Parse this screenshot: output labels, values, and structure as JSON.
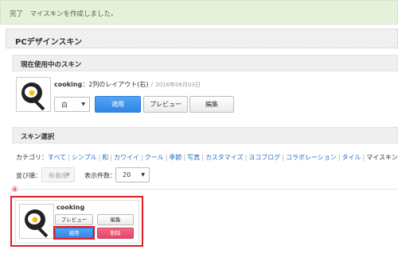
{
  "notice": {
    "text": "完了　マイスキンを作成しました。"
  },
  "page_title": "PCデザインスキン",
  "current": {
    "heading": "現在使用中のスキン",
    "skin_name": "cooking",
    "layout": "：2列のレイアウト(右)",
    "date": "2016年06月03日",
    "color_select": "白",
    "apply_label": "適用",
    "preview_label": "プレビュー",
    "edit_label": "編集"
  },
  "selection": {
    "heading": "スキン選択",
    "category_label": "カテゴリ：",
    "categories": [
      "すべて",
      "シンプル",
      "和",
      "カワイイ",
      "クール",
      "季節",
      "写真",
      "カスタマイズ",
      "ヨコブログ",
      "コラボレーション",
      "タイル",
      "マイスキン"
    ],
    "sort_label": "並び順：",
    "sort_value": "新着順",
    "count_label": "表示件数：",
    "count_value": "20"
  },
  "annotation": {
    "number": "④"
  },
  "card": {
    "skin_name": "cooking",
    "preview_label": "プレビュー",
    "edit_label": "編集",
    "apply_label": "適用",
    "delete_label": "削除"
  },
  "colors": {
    "accent_blue": "#2f86e6",
    "danger_pink": "#e04767",
    "highlight_red": "#e11b22",
    "notice_bg": "#e6f1dc"
  },
  "icons": {
    "skin_thumbnail": "frying-pan-egg-icon",
    "dropdown": "chevron-down-icon"
  }
}
